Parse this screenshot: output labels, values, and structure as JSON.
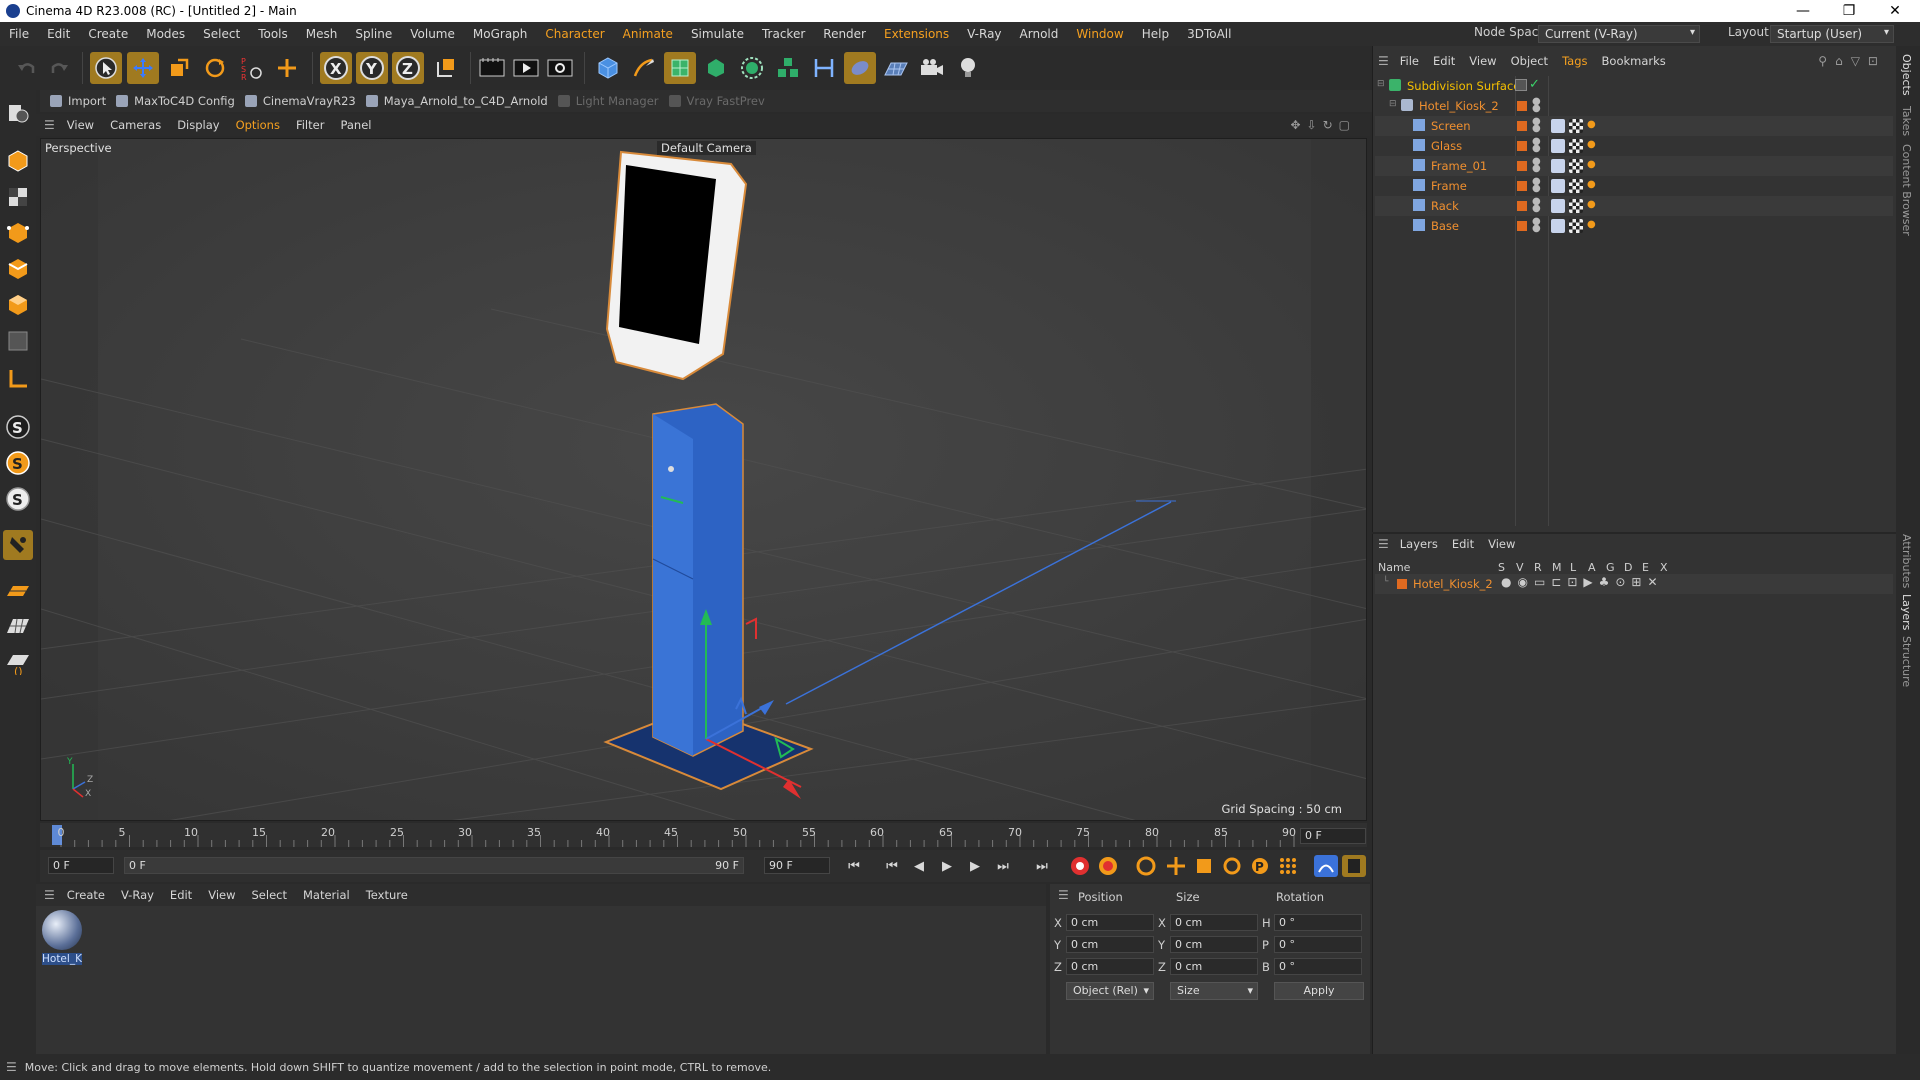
{
  "window": {
    "title": "Cinema 4D R23.008 (RC) - [Untitled 2] - Main",
    "controls": [
      "—",
      "❐",
      "✕"
    ]
  },
  "menubar": {
    "items": [
      "File",
      "Edit",
      "Create",
      "Modes",
      "Select",
      "Tools",
      "Mesh",
      "Spline",
      "Volume",
      "MoGraph",
      "Character",
      "Animate",
      "Simulate",
      "Tracker",
      "Render",
      "Extensions",
      "V-Ray",
      "Arnold",
      "Window",
      "Help",
      "3DToAll"
    ],
    "node_space_label": "Node Space:",
    "node_space_value": "Current (V-Ray)",
    "layout_label": "Layout:",
    "layout_value": "Startup (User)"
  },
  "pluginbar": {
    "items": [
      "Import",
      "MaxToC4D Config",
      "CinemaVrayR23",
      "Maya_Arnold_to_C4D_Arnold",
      "Light Manager",
      "Vray FastPrev"
    ]
  },
  "viewport": {
    "menu": [
      "View",
      "Cameras",
      "Display",
      "Options",
      "Filter",
      "Panel"
    ],
    "projection": "Perspective",
    "camera": "Default Camera",
    "grid_spacing": "Grid Spacing : 50 cm",
    "axis_y": "Y",
    "axis_z": "Z",
    "axis_x": "X"
  },
  "timeline": {
    "ticks": [
      "0",
      "5",
      "10",
      "15",
      "20",
      "25",
      "30",
      "35",
      "40",
      "45",
      "50",
      "55",
      "60",
      "65",
      "70",
      "75",
      "80",
      "85",
      "90"
    ],
    "current_frame": "0 F"
  },
  "transport": {
    "start_field": "0 F",
    "range_start": "0 F",
    "range_end": "90 F",
    "end_field": "90 F"
  },
  "material_manager": {
    "menu": [
      "Create",
      "V-Ray",
      "Edit",
      "View",
      "Select",
      "Material",
      "Texture"
    ],
    "materials": [
      {
        "name": "Hotel_Ki"
      }
    ]
  },
  "coordinates": {
    "headers": [
      "Position",
      "Size",
      "Rotation"
    ],
    "rows": [
      {
        "axis": "X",
        "position": "0 cm",
        "size_axis": "X",
        "size": "0 cm",
        "rot_axis": "H",
        "rotation": "0 °"
      },
      {
        "axis": "Y",
        "position": "0 cm",
        "size_axis": "Y",
        "size": "0 cm",
        "rot_axis": "P",
        "rotation": "0 °"
      },
      {
        "axis": "Z",
        "position": "0 cm",
        "size_axis": "Z",
        "size": "0 cm",
        "rot_axis": "B",
        "rotation": "0 °"
      }
    ],
    "mode": "Object (Rel)",
    "size_mode": "Size",
    "apply": "Apply"
  },
  "object_manager": {
    "menu": [
      "File",
      "Edit",
      "View",
      "Object",
      "Tags",
      "Bookmarks"
    ],
    "objects": [
      {
        "name": "Subdivision Surface"
      },
      {
        "name": "Hotel_Kiosk_2"
      },
      {
        "name": "Screen"
      },
      {
        "name": "Glass"
      },
      {
        "name": "Frame_01"
      },
      {
        "name": "Frame"
      },
      {
        "name": "Rack"
      },
      {
        "name": "Base"
      }
    ]
  },
  "layer_manager": {
    "menu": [
      "Layers",
      "Edit",
      "View"
    ],
    "columns": [
      "Name",
      "S",
      "V",
      "R",
      "M",
      "L",
      "A",
      "G",
      "D",
      "E",
      "X"
    ],
    "layers": [
      {
        "name": "Hotel_Kiosk_2"
      }
    ]
  },
  "side_tabs": [
    "Objects",
    "Takes",
    "Content Browser",
    "Attributes",
    "Layers",
    "Structure"
  ],
  "status": "Move: Click and drag to move elements. Hold down SHIFT to quantize movement / add to the selection in point mode, CTRL to remove.",
  "colors": {
    "accent": "#f5a020",
    "selection": "#a07a20",
    "kiosk_body": "#2d63c4",
    "kiosk_frame": "#f2f2f2",
    "screen": "#000000"
  }
}
